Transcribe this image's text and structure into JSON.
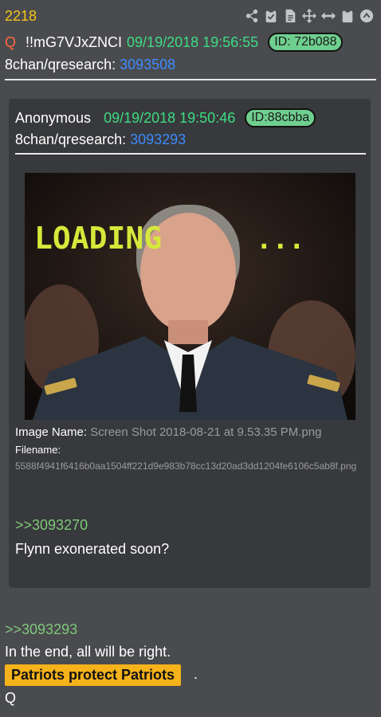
{
  "post": {
    "number": "2218",
    "q_letter": "Q",
    "tripcode": "!!mG7VJxZNCI",
    "date": "09/19/2018 19:56:55",
    "id": "ID: 72b088",
    "board_label": "8chan/qresearch:",
    "board_link": "3093508"
  },
  "toolbar": {
    "icons": [
      "share-icon",
      "check-clipboard-icon",
      "document-icon",
      "move-icon",
      "expand-icon",
      "clipboard-icon",
      "scroll-up-icon"
    ]
  },
  "quoted": {
    "name": "Anonymous",
    "date": "09/19/2018 19:50:46",
    "id": "ID:88cbba",
    "board_label": "8chan/qresearch:",
    "board_link": "3093293",
    "image_overlay_text": "LOADING",
    "image_overlay_dots": "...",
    "image_name_label": "Image Name:",
    "image_name": "Screen Shot 2018-08-21 at 9.53.35 PM.png",
    "filename_label": "Filename:",
    "filename": "5588f4941f6416b0aa1504ff221d9e983b78cc13d20ad3dd1204fe6106c5ab8f.png",
    "reply_ref": ">>3093270",
    "text": "Flynn exonerated soon?"
  },
  "reply": {
    "ref": ">>3093293",
    "line1": "In the end, all will be right.",
    "highlight": "Patriots protect Patriots",
    "punct": ".",
    "signature": "Q"
  },
  "colors": {
    "background": "#4a4b4e",
    "quote_box": "#38393c",
    "date_green": "#3ddc84",
    "link_blue": "#3d8bff",
    "post_number_yellow": "#f5c518",
    "highlight_yellow": "#f5b21a",
    "reply_green": "#7ec87a",
    "id_badge": "#6fcf8f"
  }
}
